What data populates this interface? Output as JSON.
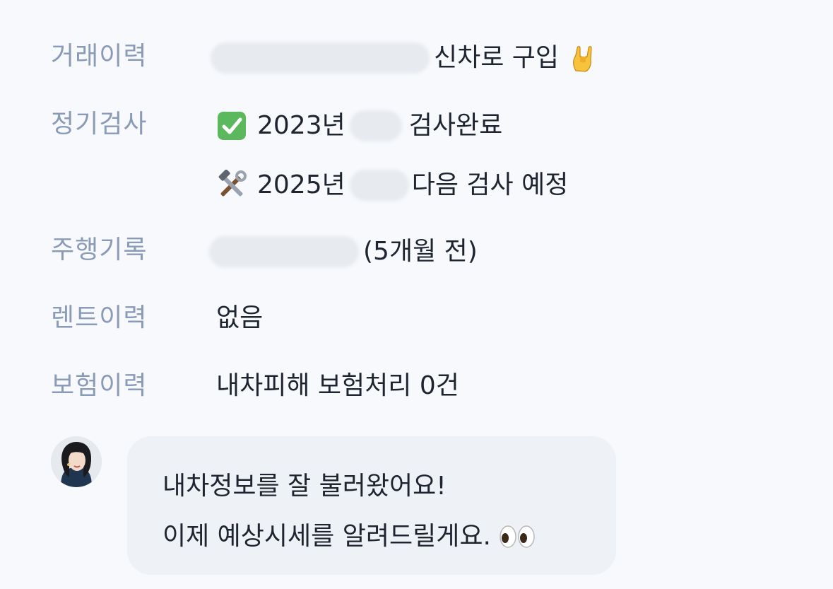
{
  "vehicle_history": {
    "trade_history": {
      "label": "거래이력",
      "value_text": "신차로 구입",
      "emoji": "sign-of-horns-icon"
    },
    "inspection": {
      "label": "정기검사",
      "line1": {
        "year": "2023년",
        "status": "검사완료",
        "emoji": "check-mark-button-icon"
      },
      "line2": {
        "year": "2025년",
        "status": "다음 검사 예정",
        "emoji": "hammer-and-wrench-icon"
      }
    },
    "driving_record": {
      "label": "주행기록",
      "value_text": "(5개월 전)"
    },
    "rental_history": {
      "label": "렌트이력",
      "value_text": "없음"
    },
    "insurance_history": {
      "label": "보험이력",
      "value_text": "내차피해 보험처리 0건"
    }
  },
  "chat": {
    "line1": "내차정보를 잘 불러왔어요!",
    "line2": "이제 예상시세를 알려드릴게요.",
    "emoji": "eyes-icon"
  },
  "colors": {
    "background": "#f7f9fc",
    "label": "#8a9bb8",
    "text": "#1f2530",
    "bubble": "#eef1f5",
    "check_green": "#5cb85c"
  }
}
